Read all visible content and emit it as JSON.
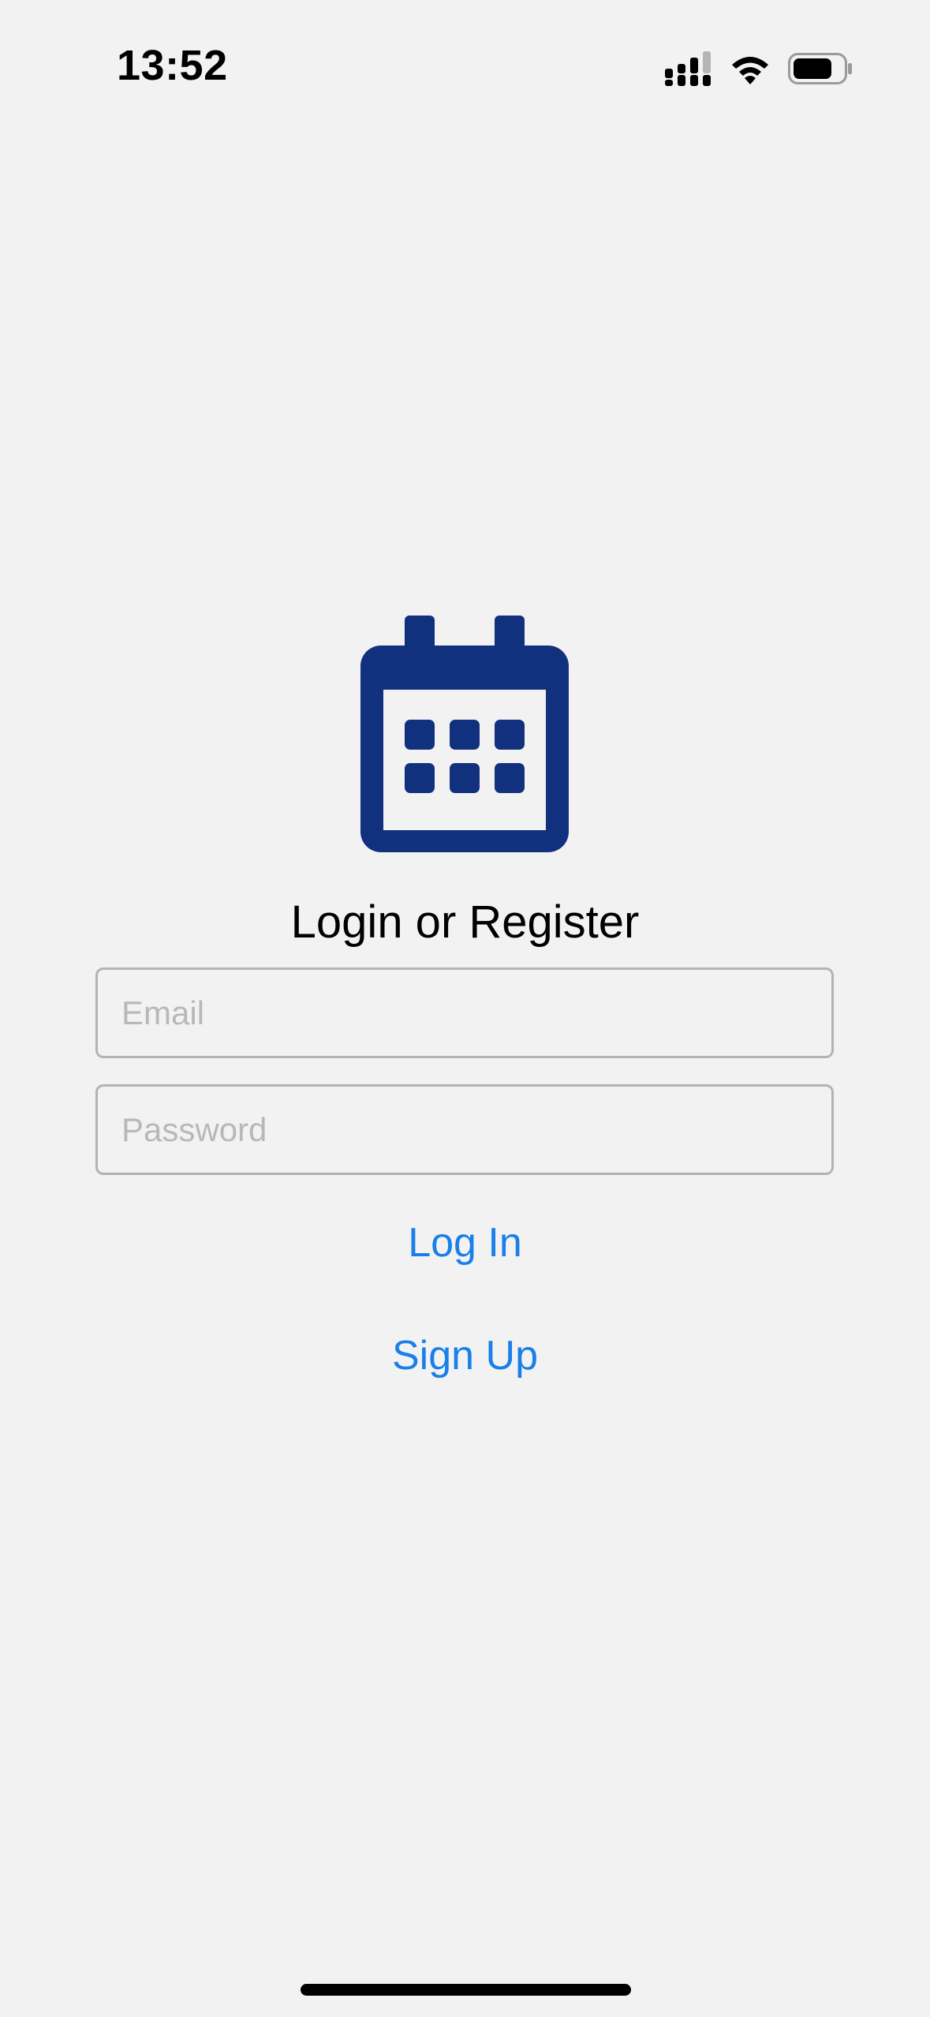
{
  "status_bar": {
    "time": "13:52"
  },
  "screen": {
    "title": "Login or Register",
    "email": {
      "value": "",
      "placeholder": "Email"
    },
    "password": {
      "value": "",
      "placeholder": "Password"
    },
    "login_label": "Log In",
    "signup_label": "Sign Up"
  },
  "colors": {
    "background": "#f2f2f2",
    "logo": "#11307d",
    "link": "#1a7fe8",
    "field_border": "#b3b3b3"
  },
  "icons": {
    "logo": "calendar-icon",
    "signal": "cellular-signal-icon",
    "wifi": "wifi-icon",
    "battery": "battery-icon"
  }
}
